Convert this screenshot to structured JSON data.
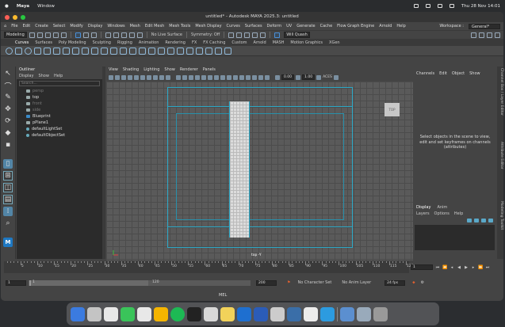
{
  "macmenu": {
    "app": "Maya",
    "items": [
      "Window"
    ],
    "clock": "Thu 28 Nov  14:01"
  },
  "window": {
    "title": "untitled* - Autodesk MAYA 2025.3: untitled"
  },
  "menus": [
    "File",
    "Edit",
    "Create",
    "Select",
    "Modify",
    "Display",
    "Windows",
    "Mesh",
    "Edit Mesh",
    "Mesh Tools",
    "Mesh Display",
    "Curves",
    "Surfaces",
    "Deform",
    "UV",
    "Generate",
    "Cache",
    "Flow Graph Engine",
    "Arnold",
    "Help"
  ],
  "workspace": {
    "label": "Workspace :",
    "value": "General*"
  },
  "status": {
    "mode": "Modeling",
    "live_surface": "No Live Surface",
    "symmetry": "Symmetry: Off",
    "user": "Will Quash"
  },
  "shelf_tabs": [
    "Curves",
    "Surfaces",
    "Poly Modeling",
    "Sculpting",
    "Rigging",
    "Animation",
    "Rendering",
    "FX",
    "FX Caching",
    "Custom",
    "Arnold",
    "MASH",
    "Motion Graphics",
    "XGen"
  ],
  "outliner": {
    "title": "Outliner",
    "menu": [
      "Display",
      "Show",
      "Help"
    ],
    "search_placeholder": "Search...",
    "items": [
      {
        "label": "persp",
        "dim": true
      },
      {
        "label": "top",
        "dim": false
      },
      {
        "label": "front",
        "dim": true
      },
      {
        "label": "side",
        "dim": true
      },
      {
        "label": "Blueprint",
        "dim": false
      },
      {
        "label": "pPlane1",
        "dim": false
      },
      {
        "label": "defaultLightSet",
        "dim": false
      },
      {
        "label": "defaultObjectSet",
        "dim": false
      }
    ]
  },
  "viewport": {
    "menu": [
      "View",
      "Shading",
      "Lighting",
      "Show",
      "Renderer",
      "Panels"
    ],
    "field_a": "0.00",
    "field_b": "1.00",
    "colorspace": "ACES",
    "camera_label": "top -Y",
    "cube_label": "TOP"
  },
  "channel_box": {
    "menu": [
      "Channels",
      "Edit",
      "Object",
      "Show"
    ],
    "message": "Select objects in the scene to view, edit and set keyframes on channels (attributes)"
  },
  "layers": {
    "tabs": [
      "Display",
      "Anim"
    ],
    "menu": [
      "Layers",
      "Options",
      "Help"
    ]
  },
  "side_tabs": [
    "Channel Box / Layer Editor",
    "Attribute Editor",
    "Modeling Toolkit"
  ],
  "timeline": {
    "ticks": [
      "5",
      "10",
      "15",
      "20",
      "25",
      "30",
      "35",
      "40",
      "45",
      "50",
      "55",
      "60",
      "65",
      "70",
      "75",
      "80",
      "85",
      "90",
      "95",
      "100",
      "105",
      "110",
      "115",
      "120"
    ],
    "current_frame": "1"
  },
  "range": {
    "start": "1",
    "inner_start": "1",
    "inner_end": "120",
    "end": "200",
    "character_set": "No Character Set",
    "anim_layer": "No Anim Layer",
    "fps": "24 fps"
  },
  "mel": {
    "label": "MEL"
  }
}
